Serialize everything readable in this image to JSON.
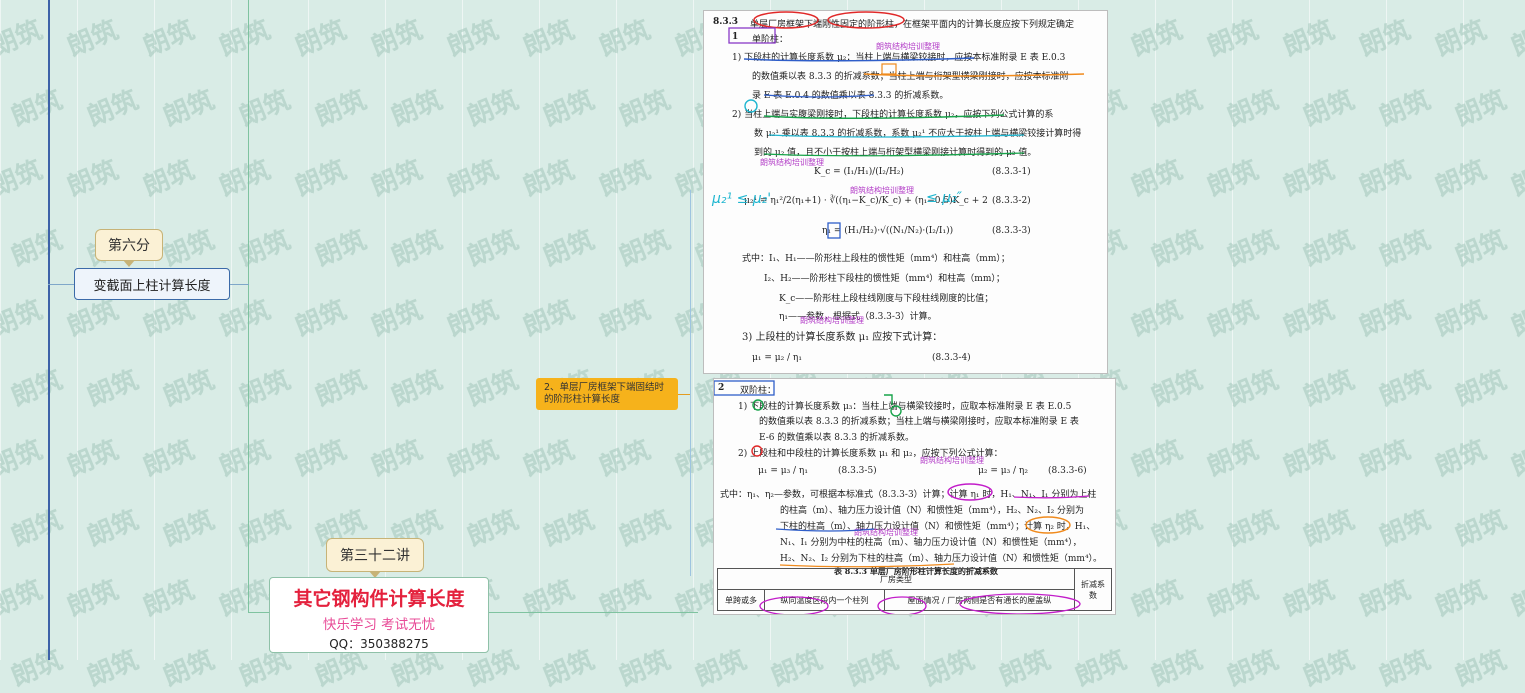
{
  "canvas": {
    "bg": "#d9ece6",
    "watermark_text": "朗筑"
  },
  "mindmap": {
    "callout_lecture_6": "第六分",
    "node_variable_section": "变截面上柱计算长度",
    "node_single_factory": "2、单层厂房框架下端固结时的阶形柱计算长度",
    "callout_lecture_32": "第三十二讲"
  },
  "logo": {
    "title": "其它钢构件计算长度",
    "slogan": "快乐学习  考试无忧",
    "qq": "QQ：350388275"
  },
  "doc1": {
    "heading_num": "8.3.3",
    "heading_text": "单层厂房框架下端刚性固定的阶形柱，在框架平面内的计算长度应按下列规定确定",
    "sec1_num": "1",
    "sec1_title": "单阶柱：",
    "l1": "1)  下段柱的计算长度系数 μ₂：当柱上端与横梁铰接时，应按本标准附录 E 表 E.0.3",
    "l2": "的数值乘以表 8.3.3 的折减系数；当柱上端与桁架型横梁刚接时，应按本标准附",
    "l3": "录 E 表 E.0.4 的数值乘以表 8.3.3 的折减系数。",
    "l4": "2)  当柱上端与实腹梁刚接时，下段柱的计算长度系数 μ₂，应按下列公式计算的系",
    "l5": "数 μ₂¹ 乘以表 8.3.3 的折减系数，系数 μ₂¹ 不应大于按柱上端与横梁铰接计算时得",
    "l6": "到的 μ₂ 值，且不小于按柱上端与桁架型横梁刚接计算时得到的 μ₂ 值。",
    "f1": "K_c = (I₁/H₁)/(I₂/H₂)",
    "f1n": "(8.3.3-1)",
    "f2": "μ₂¹ = η₁²/2(η₁+1) · ∛((η₁−K_c)/K_c) + (η₁−0.5)K_c + 2",
    "f2n": "(8.3.3-2)",
    "f3": "η₁ = (H₁/H₂)·√((N₁/N₂)·(I₂/I₁))",
    "f3n": "(8.3.3-3)",
    "w1": "式中：I₁、H₁——阶形柱上段柱的惯性矩（mm⁴）和柱高（mm）；",
    "w2": "I₂、H₂——阶形柱下段柱的惯性矩（mm⁴）和柱高（mm）；",
    "w3": "K_c——阶形柱上段柱线刚度与下段柱线刚度的比值；",
    "w4": "η₁——参数，根据式（8.3.3-3）计算。",
    "l7": "3)  上段柱的计算长度系数 μ₁ 应按下式计算：",
    "f4": "μ₁ = μ₂ / η₁",
    "f4n": "(8.3.3-4)",
    "ink1": "朗筑结构培训整理",
    "hand1": "μ₂¹ ≤ μ₂'",
    "hand2": "≤ μ₂″"
  },
  "doc2": {
    "sec2_num": "2",
    "sec2_title": "双阶柱：",
    "l1": "1)  下段柱的计算长度系数 μ₃：当柱上端与横梁铰接时，应取本标准附录 E 表 E.0.5",
    "l2": "的数值乘以表 8.3.3 的折减系数；当柱上端与横梁刚接时，应取本标准附录 E 表",
    "l3": "E-6 的数值乘以表 8.3.3 的折减系数。",
    "l4": "2)  上段柱和中段柱的计算长度系数 μ₁ 和 μ₂，应按下列公式计算：",
    "f5": "μ₁ = μ₃ / η₁",
    "f5n": "(8.3.3-5)",
    "f6": "μ₂ = μ₃ / η₂",
    "f6n": "(8.3.3-6)",
    "l5": "式中：η₁、η₂—参数，可根据本标准式（8.3.3-3）计算；计算 η₁ 时，H₁、N₁、I₁ 分别为上柱",
    "l6": "的柱高（m）、轴力压力设计值（N）和惯性矩（mm⁴），H₂、N₂、I₂ 分别为",
    "l7": "下柱的柱高（m）、轴力压力设计值（N）和惯性矩（mm⁴）；计算 η₂ 时，H₁、",
    "l8": "N₁、I₁ 分别为中柱的柱高（m）、轴力压力设计值（N）和惯性矩（mm⁴），",
    "l9": "H₂、N₂、I₂ 分别为下柱的柱高（m）、轴力压力设计值（N）和惯性矩（mm⁴）。",
    "table_title": "表 8.3.3 单层厂房阶形柱计算长度的折减系数",
    "th_factory": "厂房类型",
    "th_reduce": "折减系数",
    "td_a": "单跨或多",
    "td_b": "纵向温度区段内一个柱列",
    "td_c": "屋面情况",
    "td_d": "厂房两侧是否有通长的屋盖纵"
  },
  "colors": {
    "blue": "#2f5ec9",
    "red": "#e02828",
    "orange": "#f08a1c",
    "green": "#17a34a",
    "magenta": "#c21cc9",
    "cyan": "#1fb6d0"
  }
}
